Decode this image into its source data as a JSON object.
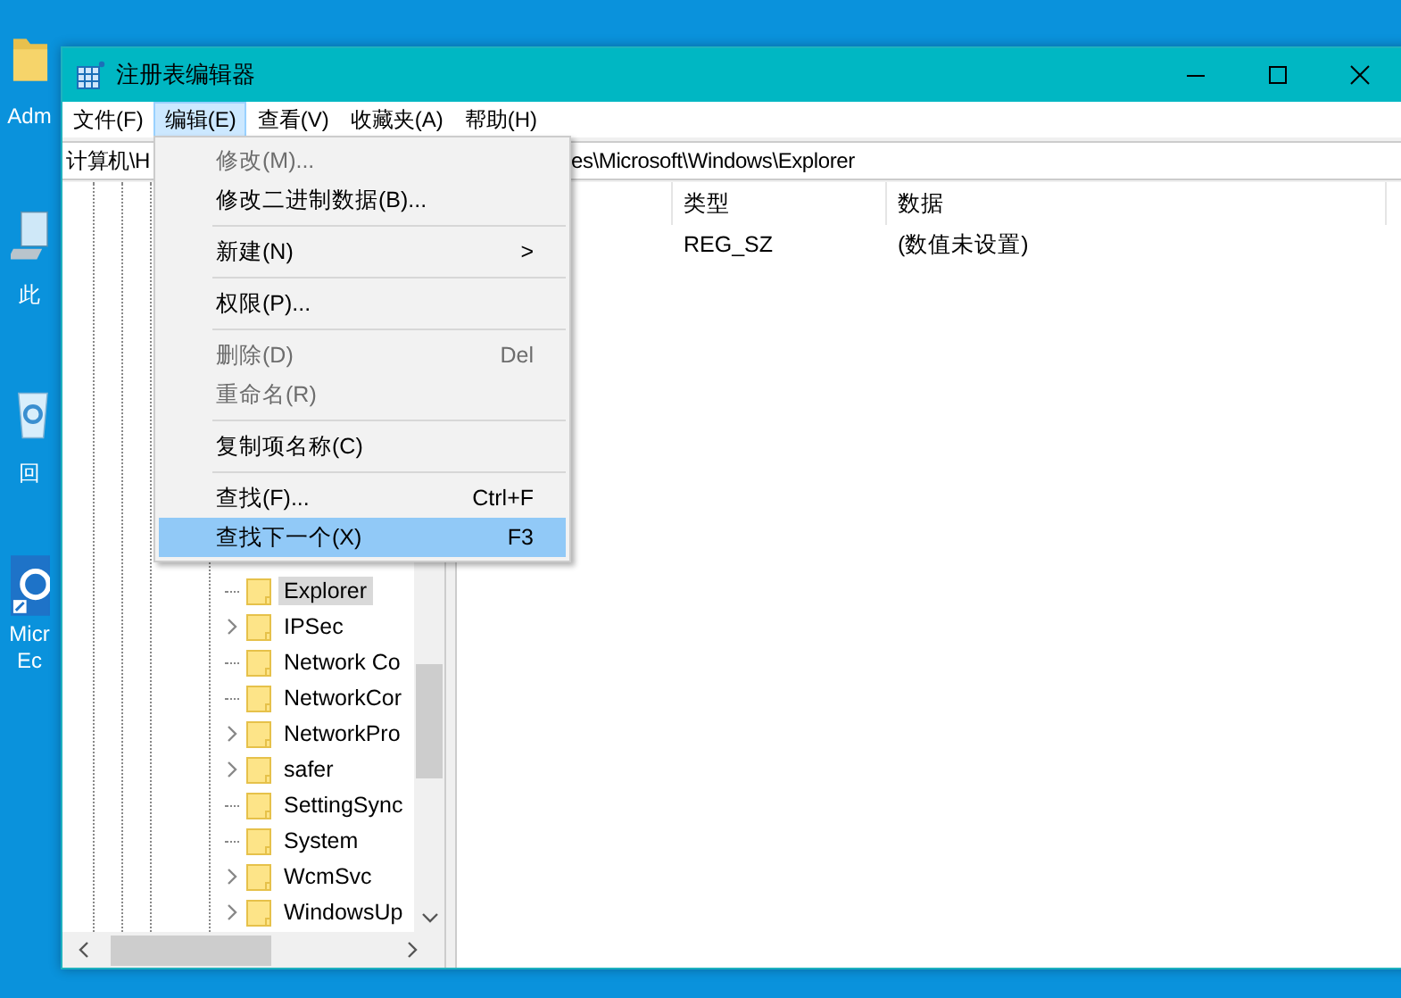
{
  "desktop": {
    "icons": [
      {
        "kind": "folder",
        "label": "Adm"
      },
      {
        "kind": "computer",
        "label": "此"
      },
      {
        "kind": "recycle",
        "label": "回"
      },
      {
        "kind": "browser",
        "label": "Micr",
        "label_2": "Ec"
      }
    ]
  },
  "window": {
    "title": "注册表编辑器"
  },
  "menu_bar": [
    {
      "label": "文件(F)",
      "selected": false
    },
    {
      "label": "编辑(E)",
      "selected": true
    },
    {
      "label": "查看(V)",
      "selected": false
    },
    {
      "label": "收藏夹(A)",
      "selected": false
    },
    {
      "label": "帮助(H)",
      "selected": false
    }
  ],
  "address": {
    "start": "计算机\\H",
    "end": "es\\Microsoft\\Windows\\Explorer"
  },
  "tree": {
    "items": [
      {
        "label": "Explorer",
        "expandable": false,
        "selected": true
      },
      {
        "label": "IPSec",
        "expandable": true,
        "selected": false
      },
      {
        "label": "Network Co",
        "expandable": false,
        "selected": false
      },
      {
        "label": "NetworkCor",
        "expandable": false,
        "selected": false
      },
      {
        "label": "NetworkPro",
        "expandable": true,
        "selected": false
      },
      {
        "label": "safer",
        "expandable": true,
        "selected": false
      },
      {
        "label": "SettingSync",
        "expandable": false,
        "selected": false
      },
      {
        "label": "System",
        "expandable": false,
        "selected": false
      },
      {
        "label": "WcmSvc",
        "expandable": true,
        "selected": false
      },
      {
        "label": "WindowsUp",
        "expandable": true,
        "selected": false
      }
    ]
  },
  "values": {
    "columns": [
      "类型",
      "数据"
    ],
    "rows": [
      [
        "REG_SZ",
        "(数值未设置)"
      ]
    ]
  },
  "edit_menu": [
    {
      "kind": "item",
      "label": "修改(M)...",
      "disabled": true,
      "selected": false
    },
    {
      "kind": "item",
      "label": "修改二进制数据(B)...",
      "disabled": false,
      "selected": false
    },
    {
      "kind": "separator"
    },
    {
      "kind": "item",
      "label": "新建(N)",
      "submenu": ">",
      "disabled": false,
      "selected": false
    },
    {
      "kind": "separator"
    },
    {
      "kind": "item",
      "label": "权限(P)...",
      "disabled": false,
      "selected": false
    },
    {
      "kind": "separator"
    },
    {
      "kind": "item",
      "label": "删除(D)",
      "shortcut": "Del",
      "disabled": true,
      "selected": false
    },
    {
      "kind": "item",
      "label": "重命名(R)",
      "disabled": true,
      "selected": false
    },
    {
      "kind": "separator"
    },
    {
      "kind": "item",
      "label": "复制项名称(C)",
      "disabled": false,
      "selected": false
    },
    {
      "kind": "separator"
    },
    {
      "kind": "item",
      "label": "查找(F)...",
      "shortcut": "Ctrl+F",
      "disabled": false,
      "selected": false
    },
    {
      "kind": "item",
      "label": "查找下一个(X)",
      "shortcut": "F3",
      "disabled": false,
      "selected": true
    }
  ]
}
